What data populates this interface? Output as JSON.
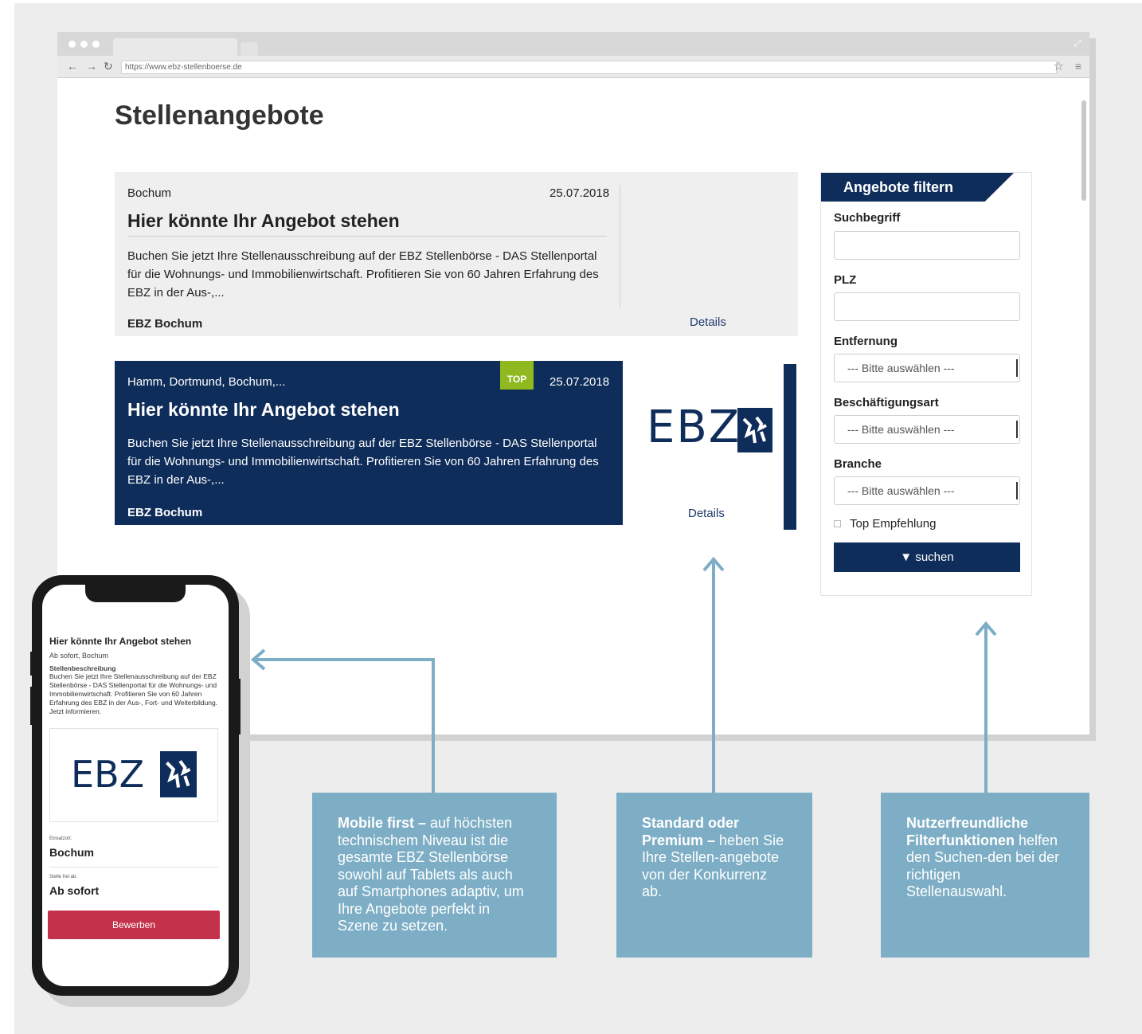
{
  "browser": {
    "url": "https://www.ebz-stellenboerse.de"
  },
  "page": {
    "title": "Stellenangebote"
  },
  "jobs": [
    {
      "location": "Bochum",
      "date": "25.07.2018",
      "title": "Hier könnte Ihr Angebot stehen",
      "description": "Buchen Sie jetzt Ihre Stellenausschreibung auf der EBZ Stellenbörse - DAS Stellenportal für die Wohnungs- und Immobilienwirtschaft. Profitieren Sie von 60 Jahren Erfahrung des EBZ in der Aus-,...",
      "company": "EBZ Bochum",
      "details_label": "Details"
    },
    {
      "location": "Hamm, Dortmund, Bochum,...",
      "badge": "TOP",
      "date": "25.07.2018",
      "title": "Hier könnte Ihr Angebot stehen",
      "description": "Buchen Sie jetzt Ihre Stellenausschreibung auf der EBZ Stellenbörse - DAS Stellenportal für die Wohnungs- und Immobilienwirtschaft. Profitieren Sie von 60 Jahren Erfahrung des EBZ in der Aus-,...",
      "company": "EBZ Bochum",
      "details_label": "Details",
      "logo_text": "EBZ"
    }
  ],
  "filter": {
    "heading": "Angebote filtern",
    "search_label": "Suchbegriff",
    "plz_label": "PLZ",
    "distance_label": "Entfernung",
    "distance_value": "--- Bitte auswählen ---",
    "employment_label": "Beschäftigungsart",
    "employment_value": "--- Bitte auswählen ---",
    "industry_label": "Branche",
    "industry_value": "--- Bitte auswählen ---",
    "top_label": "Top Empfehlung",
    "submit_label": "suchen"
  },
  "phone": {
    "title": "Hier könnte Ihr Angebot stehen",
    "subtitle": "Ab sofort, Bochum",
    "desc_heading": "Stellenbeschreibung",
    "description": "Buchen Sie jetzt Ihre Stellenausschreibung auf der EBZ Stellenbörse - DAS Stellenportal für die Wohnungs- und Immobilienwirtschaft. Profitieren Sie von 60 Jahren Erfahrung des EBZ in der Aus-, Fort- und Weiterbildung. Jetzt informieren.",
    "logo_text": "EBZ",
    "location_label": "Einsatzort:",
    "location_value": "Bochum",
    "start_label": "Stelle frei ab:",
    "start_value": "Ab sofort",
    "apply_label": "Bewerben"
  },
  "callouts": [
    {
      "bold": "Mobile first –",
      "text": " auf höchsten technischem Niveau ist die gesamte EBZ Stellenbörse sowohl auf Tablets als auch auf Smartphones adaptiv, um Ihre Angebote perfekt in Szene zu setzen."
    },
    {
      "bold": "Standard oder Premium –",
      "text": " heben Sie Ihre Stellen-angebote von der Konkurrenz ab."
    },
    {
      "bold": "Nutzerfreundliche Filterfunktionen",
      "text": " helfen den Suchen-den bei der richtigen Stellenauswahl."
    }
  ],
  "colors": {
    "navy": "#0f2d5a",
    "callout": "#7eaec5",
    "top_badge": "#8fb91f",
    "apply_button": "#c4314b",
    "background": "#ededed"
  }
}
